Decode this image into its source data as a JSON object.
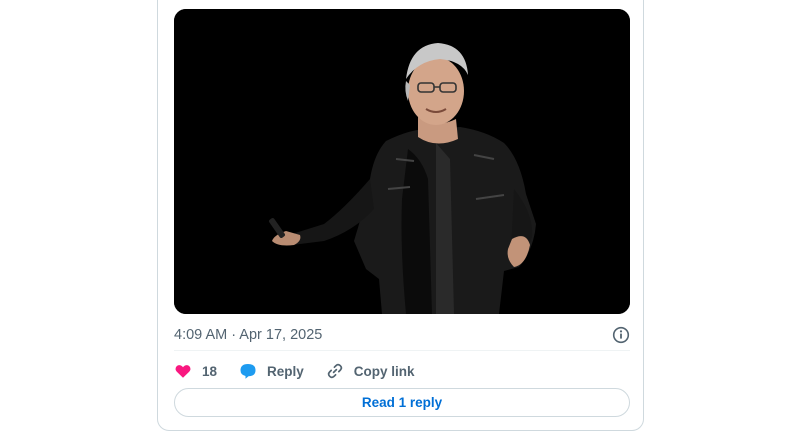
{
  "post": {
    "image_alt": "Person in black leather jacket on stage",
    "timestamp": "4:09 AM · Apr 17, 2025",
    "info_icon": "info-icon"
  },
  "actions": {
    "like": {
      "icon": "heart-icon",
      "count": "18",
      "color": "#f91880"
    },
    "reply": {
      "icon": "speech-bubble-icon",
      "label": "Reply",
      "color": "#1d9bf0"
    },
    "copy": {
      "icon": "link-icon",
      "label": "Copy link"
    }
  },
  "read_replies": {
    "label": "Read 1 reply",
    "color": "#006fd6"
  }
}
